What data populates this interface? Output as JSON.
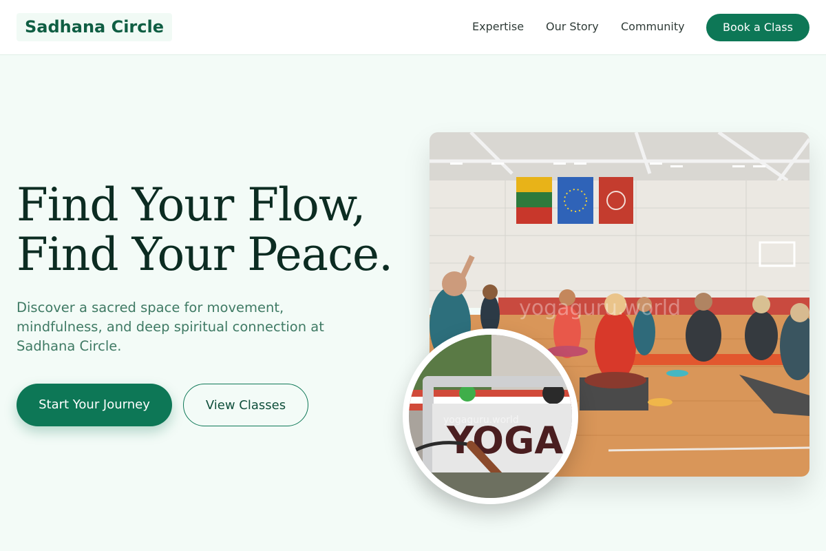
{
  "brand": {
    "name": "Sadhana Circle"
  },
  "nav": {
    "items": [
      "Expertise",
      "Our Story",
      "Community"
    ],
    "cta_label": "Book a Class"
  },
  "hero": {
    "title_line1": "Find Your Flow,",
    "title_line2": "Find Your Peace.",
    "subtitle": "Discover a sacred space for movement, mindfulness, and deep spiritual connection at Sadhana Circle.",
    "primary_label": "Start Your Journey",
    "secondary_label": "View Classes"
  },
  "images": {
    "main_watermark": "yogaguru.world",
    "circle_sign_text": "YOGA",
    "circle_watermark": "yogaguru.world"
  },
  "colors": {
    "accent": "#0d7756",
    "background": "#f3fbf7",
    "title": "#0c2c22",
    "subtitle": "#3f7a64"
  }
}
